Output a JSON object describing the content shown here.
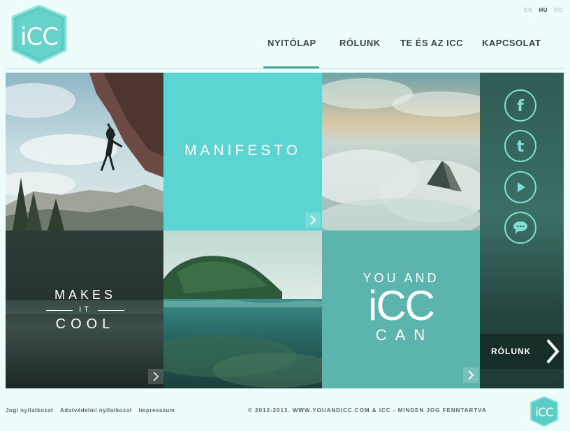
{
  "logo": {
    "text": "iCC"
  },
  "languages": [
    {
      "code": "EN",
      "active": false
    },
    {
      "code": "HU",
      "active": true
    },
    {
      "code": "RO",
      "active": false
    }
  ],
  "nav": [
    {
      "label": "NYITÓLAP",
      "active": true
    },
    {
      "label": "RÓLUNK",
      "active": false
    },
    {
      "label": "TE ÉS AZ ICC",
      "active": false
    },
    {
      "label": "KAPCSOLAT",
      "active": false
    }
  ],
  "tiles": {
    "manifesto": "MANIFESTO",
    "makes": {
      "line1": "MAKES",
      "line2": "IT",
      "line3": "COOL"
    },
    "youand": {
      "line1": "YOU AND",
      "line2": "iCC",
      "line3": "CAN"
    }
  },
  "side": {
    "social": [
      {
        "icon": "facebook-icon",
        "glyph": "f"
      },
      {
        "icon": "twitter-icon",
        "glyph": "t"
      },
      {
        "icon": "youtube-play-icon",
        "glyph": "▶"
      },
      {
        "icon": "chat-bubble-icon",
        "glyph": ""
      }
    ],
    "button": "RÓLUNK"
  },
  "footer": {
    "links": [
      "Jogi nyilatkozat",
      "Adatvédelmi nyilatkozat",
      "Impresszum"
    ],
    "copyright": "© 2012-2013. WWW.YOUANDICC.COM & ICC - MINDEN JOG FENNTARTVA",
    "logo_text": "iCC"
  },
  "colors": {
    "accent": "#4aa6a2",
    "teal_light": "#56d2d0",
    "teal_mid": "#5bb4ad",
    "background": "#eefcfb"
  }
}
